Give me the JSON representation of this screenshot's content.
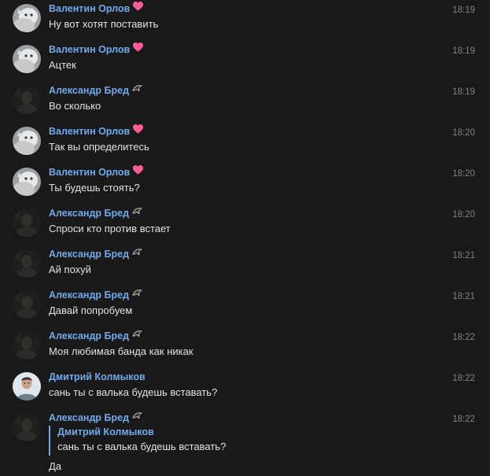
{
  "colors": {
    "background": "#19191a",
    "author": "#71aaeb",
    "text": "#e1e3e6",
    "time": "#828282",
    "heart": "#ff5b9a"
  },
  "messages": [
    {
      "author": "Валентин Орлов",
      "time": "18:19",
      "text": "Ну вот хотят поставить",
      "avatar": "cat-avatar",
      "badge": "heart-icon"
    },
    {
      "author": "Валентин Орлов",
      "time": "18:19",
      "text": "Ацтек",
      "avatar": "cat-avatar",
      "badge": "heart-icon"
    },
    {
      "author": "Александр Бред",
      "time": "18:19",
      "text": "Во сколько",
      "avatar": "dark-avatar",
      "badge": "bird-icon"
    },
    {
      "author": "Валентин Орлов",
      "time": "18:20",
      "text": "Так вы определитесь",
      "avatar": "cat-avatar",
      "badge": "heart-icon"
    },
    {
      "author": "Валентин Орлов",
      "time": "18:20",
      "text": "Ты будешь стоять?",
      "avatar": "cat-avatar",
      "badge": "heart-icon"
    },
    {
      "author": "Александр Бред",
      "time": "18:20",
      "text": "Спроси кто против встает",
      "avatar": "dark-avatar",
      "badge": "bird-icon"
    },
    {
      "author": "Александр Бред",
      "time": "18:21",
      "text": "Ай похуй",
      "avatar": "dark-avatar",
      "badge": "bird-icon"
    },
    {
      "author": "Александр Бред",
      "time": "18:21",
      "text": "Давай попробуем",
      "avatar": "dark-avatar",
      "badge": "bird-icon"
    },
    {
      "author": "Александр Бред",
      "time": "18:22",
      "text": "Моя любимая банда как никак",
      "avatar": "dark-avatar",
      "badge": "bird-icon"
    },
    {
      "author": "Дмитрий Колмыков",
      "time": "18:22",
      "text": "сань ты с валька будешь вставать?",
      "avatar": "person-avatar",
      "badge": ""
    },
    {
      "author": "Александр Бред",
      "time": "18:22",
      "text": "Да",
      "avatar": "dark-avatar",
      "badge": "bird-icon",
      "reply": {
        "author": "Дмитрий Колмыков",
        "text": "сань ты с валька будешь вставать?"
      }
    }
  ]
}
